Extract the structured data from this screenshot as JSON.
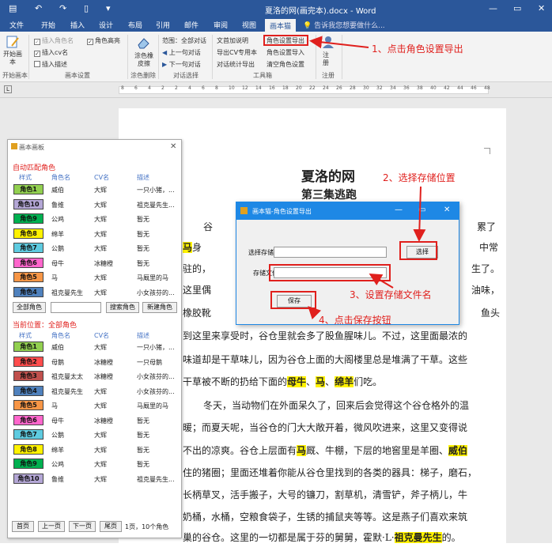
{
  "window": {
    "title": "夏洛的网(画完本).docx - Word",
    "minimize": "—",
    "restore": "▭",
    "close": "✕"
  },
  "quick_access": {
    "save": "▤",
    "undo": "↶",
    "redo": "↷",
    "new": "▯",
    "more": "▾"
  },
  "tabs": [
    "文件",
    "开始",
    "插入",
    "设计",
    "布局",
    "引用",
    "邮件",
    "审阅",
    "视图",
    "画本猫"
  ],
  "tell_me": "告诉我您想要做什么...",
  "ribbon": {
    "start_label": "开始画本",
    "start_group": "开始画本",
    "settings": {
      "insert_role_name": "插入角色名",
      "role_highlight": "角色高亮",
      "insert_cv_name": "插入cv名",
      "insert_description": "插入描述",
      "group": "画本设置"
    },
    "eraser": {
      "label": "涂色橡皮擦",
      "group": "涂色删除"
    },
    "dialog_select": {
      "range": "范围：全部对话",
      "prev": "上一句对话",
      "next": "下一句对话",
      "group": "对话选择"
    },
    "toolbox": {
      "items": [
        "文首加说明",
        "角色设置导出",
        "导出CV专用本",
        "角色设置导入",
        "对话统计导出",
        "清空角色设置"
      ],
      "group": "工具箱"
    },
    "register": {
      "label": "注册",
      "group": "注册"
    }
  },
  "ruler_numbers": [
    "8",
    "6",
    "4",
    "2",
    "2",
    "4",
    "6",
    "8",
    "10",
    "12",
    "14",
    "16",
    "18",
    "20",
    "22",
    "24",
    "26",
    "28",
    "30",
    "32",
    "34",
    "36",
    "38",
    "40",
    "42",
    "44",
    "46",
    "48"
  ],
  "annotations": {
    "step1": "1、点击角色设置导出",
    "step2": "2、选择存储位置",
    "step3": "3、设置存储文件名",
    "step4": "4、点击保存按钮"
  },
  "document": {
    "title": "夏洛的网",
    "subtitle": "第三集逃跑",
    "para1_top_left": "谷",
    "para1_top_right": "累了",
    "line_ma": "马",
    "line_ma_rest": "身",
    "line_zhongchang": "中常",
    "line2_left": "驻的，",
    "line2_right": "生了。",
    "line3_left": "这里偶",
    "line3_right": "油味，",
    "line4_left": "橡胶靴",
    "line4_right": "鱼头",
    "line5": "到这里来享受时，谷仓里就会多了股鱼腥味儿。不过，这里面最浓的",
    "line6": "味道却是干草味儿，因为谷仓上面的大阁楼里总是堆满了干草。这些",
    "line7_a": "干草被不断的扔给下面的",
    "line7_h1": "母牛",
    "line7_sep1": "、",
    "line7_h2": "马",
    "line7_sep2": "、",
    "line7_h3": "绵羊",
    "line7_b": "们吃。",
    "para2_1": "冬天，当动物们在外面呆久了，回来后会觉得这个谷仓格外的温",
    "para2_2": "暖；而夏天呢，当谷仓的门大大敞开着，微风吹进来，这里又变得说",
    "para2_3a": "不出的凉爽。谷仓上层面有",
    "para2_3h": "马",
    "para2_3b": "厩、牛棚，下层的地窖里是羊圈、",
    "para2_3h2": "威伯",
    "para2_4": "住的猪圈；里面还堆着你能从谷仓里找到的各类的器具：梯子，磨石，",
    "para2_5": "长柄草叉，活手搬子，大号的镰刀，割草机，清雪铲，斧子柄儿，牛",
    "para2_6": "奶桶，水桶，空粮食袋子，生锈的捕鼠夹等等。这是燕子们喜欢来筑",
    "para2_7a": "巢的谷仓。这里的一切都是属于芬的舅舅，霍默·L·",
    "para2_7h": "祖克曼先生",
    "para2_7b": "的。"
  },
  "panel": {
    "title": "画本画板",
    "auto_match": "自动匹配角色",
    "headers": [
      "样式",
      "角色名",
      "CV名",
      "描述"
    ],
    "auto_rows": [
      {
        "style": "角色1",
        "color": "#92d050",
        "name": "威伯",
        "cv": "大辉",
        "desc": "一只小猪，..."
      },
      {
        "style": "角色10",
        "color": "#b4a7d6",
        "name": "鲁维",
        "cv": "大辉",
        "desc": "祖克曼先生..."
      },
      {
        "style": "角色9",
        "color": "#00b050",
        "name": "公鸡",
        "cv": "大辉",
        "desc": "暂无"
      },
      {
        "style": "角色8",
        "color": "#fff200",
        "name": "绵羊",
        "cv": "大辉",
        "desc": "暂无"
      },
      {
        "style": "角色7",
        "color": "#5ecbe0",
        "name": "公鹅",
        "cv": "大辉",
        "desc": "暂无"
      },
      {
        "style": "角色6",
        "color": "#ff66cc",
        "name": "母牛",
        "cv": "冰糖橙",
        "desc": "暂无"
      },
      {
        "style": "角色5",
        "color": "#f79646",
        "name": "马",
        "cv": "大辉",
        "desc": "马厩里的马"
      },
      {
        "style": "角色4",
        "color": "#4f81bd",
        "name": "祖克曼先生",
        "cv": "大辉",
        "desc": "小女孩芬的..."
      }
    ],
    "btn_all_roles": "全部角色",
    "btn_search_role": "搜索角色",
    "btn_new_role": "新建角色",
    "current_position": "当前位置：全部角色",
    "all_rows": [
      {
        "style": "角色1",
        "color": "#92d050",
        "name": "威伯",
        "cv": "大辉",
        "desc": "一只小猪，..."
      },
      {
        "style": "角色2",
        "color": "#ff4d4d",
        "name": "母鹅",
        "cv": "冰糖橙",
        "desc": "一只母鹅"
      },
      {
        "style": "角色3",
        "color": "#c0504d",
        "name": "祖克曼太太",
        "cv": "冰糖橙",
        "desc": "小女孩芬的..."
      },
      {
        "style": "角色4",
        "color": "#4f81bd",
        "name": "祖克曼先生",
        "cv": "大辉",
        "desc": "小女孩芬的..."
      },
      {
        "style": "角色5",
        "color": "#f79646",
        "name": "马",
        "cv": "大辉",
        "desc": "马厩里的马"
      },
      {
        "style": "角色6",
        "color": "#ff66cc",
        "name": "母牛",
        "cv": "冰糖橙",
        "desc": "暂无"
      },
      {
        "style": "角色7",
        "color": "#5ecbe0",
        "name": "公鹅",
        "cv": "大辉",
        "desc": "暂无"
      },
      {
        "style": "角色8",
        "color": "#fff200",
        "name": "绵羊",
        "cv": "大辉",
        "desc": "暂无"
      },
      {
        "style": "角色9",
        "color": "#00b050",
        "name": "公鸡",
        "cv": "大辉",
        "desc": "暂无"
      },
      {
        "style": "角色10",
        "color": "#b4a7d6",
        "name": "鲁维",
        "cv": "大辉",
        "desc": "祖克曼先生..."
      }
    ],
    "pager": {
      "first": "首页",
      "prev": "上一页",
      "next": "下一页",
      "last": "尾页",
      "info": "1页，10个角色"
    }
  },
  "dialog": {
    "title": "画本猫-角色设置导出",
    "path_label": "选择存储位置",
    "path_value": "",
    "browse": "选择",
    "filename_label": "存储文件名",
    "filename_value": "",
    "save": "保存"
  }
}
